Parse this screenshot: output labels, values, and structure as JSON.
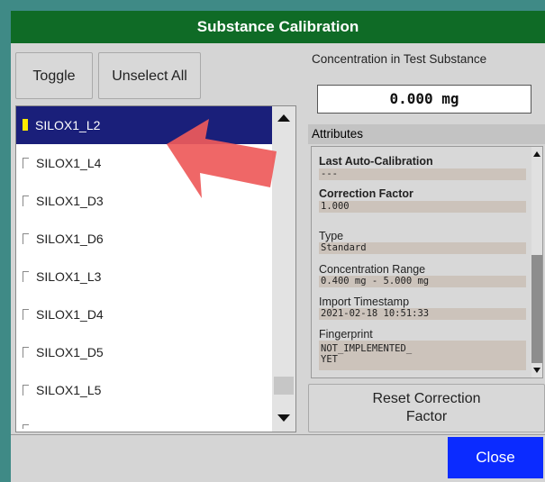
{
  "dialog": {
    "title": "Substance Calibration",
    "toggle_label": "Toggle",
    "unselect_all_label": "Unselect All",
    "close_label": "Close",
    "accent_color": "#0f6b26",
    "close_color": "#0b2bff"
  },
  "substance_list": {
    "items": [
      {
        "label": "SILOX1_L2",
        "selected": true
      },
      {
        "label": "SILOX1_L4",
        "selected": false
      },
      {
        "label": "SILOX1_D3",
        "selected": false
      },
      {
        "label": "SILOX1_D6",
        "selected": false
      },
      {
        "label": "SILOX1_L3",
        "selected": false
      },
      {
        "label": "SILOX1_D4",
        "selected": false
      },
      {
        "label": "SILOX1_D5",
        "selected": false
      },
      {
        "label": "SILOX1_L5",
        "selected": false
      }
    ],
    "scroll_up_icon": "triangle-up-icon",
    "scroll_down_icon": "triangle-down-icon"
  },
  "concentration": {
    "label": "Concentration in Test Substance",
    "value": "0.000 mg"
  },
  "attributes": {
    "header": "Attributes",
    "last_auto_calibration_label": "Last Auto-Calibration",
    "last_auto_calibration_value": "---",
    "correction_factor_label": "Correction Factor",
    "correction_factor_value": "1.000",
    "type_label": "Type",
    "type_value": "Standard",
    "concentration_range_label": "Concentration Range",
    "concentration_range_value": "0.400 mg - 5.000 mg",
    "import_timestamp_label": "Import Timestamp",
    "import_timestamp_value": "2021-02-18 10:51:33",
    "fingerprint_label": "Fingerprint",
    "fingerprint_value": "NOT_IMPLEMENTED_\nYET"
  },
  "reset_correction_factor_label": "Reset Correction\nFactor",
  "annotation_arrow_color": "#ee5a5a"
}
